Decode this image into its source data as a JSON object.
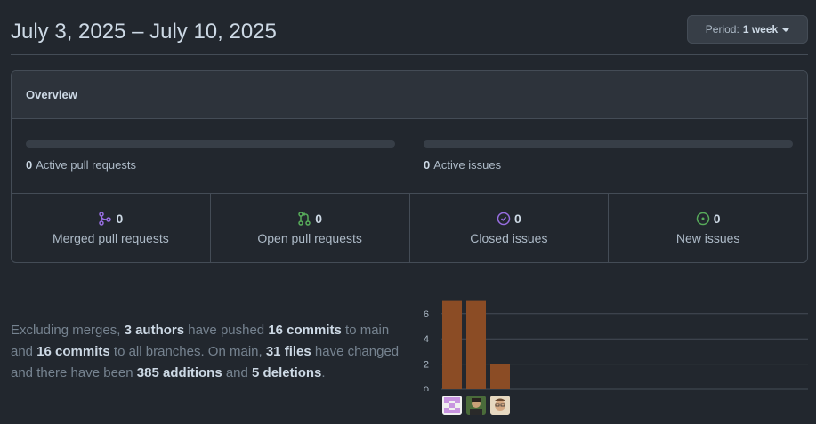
{
  "header": {
    "date_range": "July 3, 2025 – July 10, 2025"
  },
  "period": {
    "prefix": "Period:",
    "value": "1 week"
  },
  "overview": {
    "title": "Overview",
    "active_pull_requests": {
      "count": "0",
      "label": "Active pull requests",
      "fraction": 0
    },
    "active_issues": {
      "count": "0",
      "label": "Active issues",
      "fraction": 0
    },
    "stats": [
      {
        "icon": "git-merge-icon",
        "count": "0",
        "label": "Merged pull requests",
        "color": "#986ee2"
      },
      {
        "icon": "git-pull-request-icon",
        "count": "0",
        "label": "Open pull requests",
        "color": "#57ab5a"
      },
      {
        "icon": "issue-closed-icon",
        "count": "0",
        "label": "Closed issues",
        "color": "#986ee2"
      },
      {
        "icon": "issue-opened-icon",
        "count": "0",
        "label": "New issues",
        "color": "#57ab5a"
      }
    ]
  },
  "summary": {
    "t1": "Excluding merges, ",
    "authors": "3 authors",
    "t2": " have pushed ",
    "commits_main": "16 commits",
    "t3": " to main and ",
    "commits_all": "16 commits",
    "t4": " to all branches. On main, ",
    "files": "31 files",
    "t5": " have changed and there have been ",
    "additions": "385",
    "additions_word": " additions",
    "and": " and ",
    "deletions": "5",
    "deletions_word": " deletions",
    "t6": "."
  },
  "chart_data": {
    "type": "bar",
    "categories": [
      "author-1",
      "author-2",
      "author-3"
    ],
    "values": [
      7,
      7,
      2
    ],
    "yticks": [
      "6",
      "4",
      "2",
      "0"
    ],
    "ylim": [
      0,
      7
    ],
    "bar_color": "#8b4c25",
    "grid": true
  },
  "colors": {
    "accent_purple": "#986ee2",
    "accent_green": "#57ab5a",
    "deletion_red": "#e5534b"
  }
}
